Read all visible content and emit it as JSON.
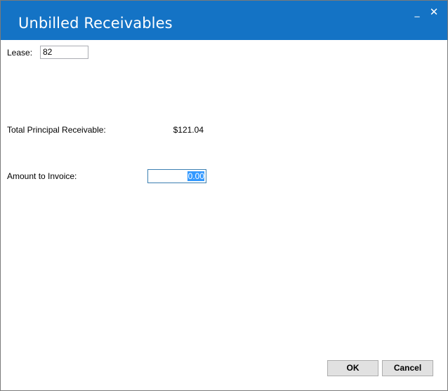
{
  "window": {
    "title": "Unbilled Receivables",
    "minimize_glyph": "_",
    "close_glyph": "✕",
    "accent_color": "#1473c5"
  },
  "form": {
    "lease_label": "Lease:",
    "lease_value": "82",
    "principal_label": "Total Principal Receivable:",
    "principal_value": "$121.04",
    "amount_label": "Amount to Invoice:",
    "amount_value": "0.00"
  },
  "buttons": {
    "ok_label": "OK",
    "cancel_label": "Cancel"
  }
}
